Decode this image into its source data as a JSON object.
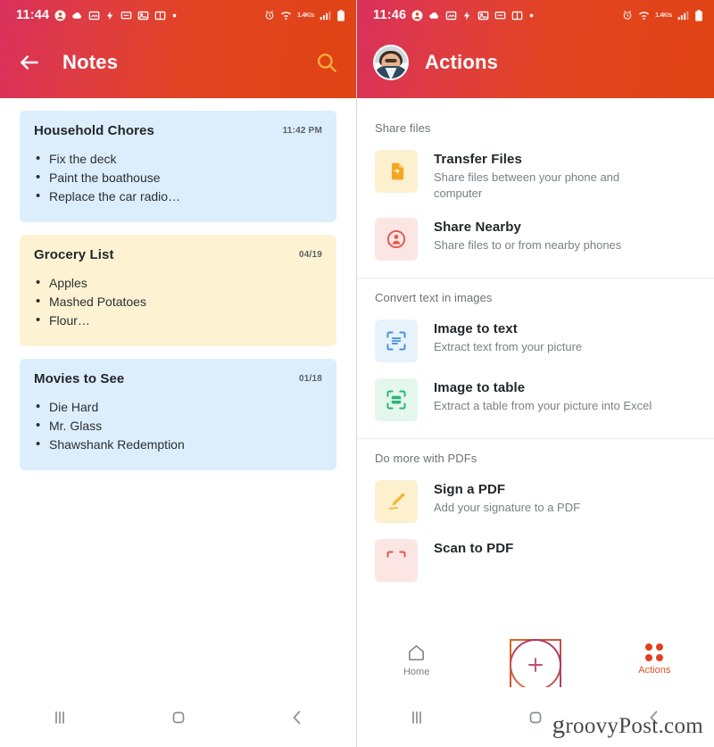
{
  "notes_phone": {
    "status_bar": {
      "time": "11:44",
      "network_speed": "1.4K/s",
      "icons": [
        "contact-icon",
        "weather-icon",
        "screenshot-icon",
        "flash-icon",
        "message-icon",
        "gallery-icon",
        "book-icon",
        "dot-icon"
      ],
      "right_icons": [
        "alarm-icon",
        "wifi-icon",
        "signal-icon",
        "battery-icon"
      ]
    },
    "app_bar": {
      "back_label": "back",
      "title": "Notes",
      "search_label": "search"
    },
    "notes": [
      {
        "title": "Household Chores",
        "stamp": "11:42 PM",
        "color": "blue",
        "items": [
          "Fix the deck",
          "Paint the boathouse",
          "Replace the car radio…"
        ]
      },
      {
        "title": "Grocery List",
        "stamp": "04/19",
        "color": "yellow",
        "items": [
          "Apples",
          "Mashed Potatoes",
          "Flour…"
        ]
      },
      {
        "title": "Movies to See",
        "stamp": "01/18",
        "color": "blue",
        "items": [
          "Die Hard",
          "Mr. Glass",
          "Shawshank Redemption"
        ]
      }
    ],
    "nav": {
      "recents": "recents",
      "home": "home",
      "back": "back"
    }
  },
  "actions_phone": {
    "status_bar": {
      "time": "11:46",
      "network_speed": "1.4K/s",
      "icons": [
        "contact-icon",
        "weather-icon",
        "screenshot-icon",
        "flash-icon",
        "gallery-icon",
        "message-icon",
        "book-icon",
        "dot-icon"
      ],
      "right_icons": [
        "alarm-icon",
        "wifi-icon",
        "signal-icon",
        "battery-icon"
      ]
    },
    "app_bar": {
      "title": "Actions",
      "avatar_label": "profile photo"
    },
    "sections": [
      {
        "title": "Share files",
        "rows": [
          {
            "icon": "transfer-files-icon",
            "icon_style": "ico-amber",
            "title": "Transfer Files",
            "subtitle": "Share files between your phone and computer"
          },
          {
            "icon": "share-nearby-icon",
            "icon_style": "ico-pink",
            "title": "Share Nearby",
            "subtitle": "Share files to or from nearby phones"
          }
        ]
      },
      {
        "title": "Convert text in images",
        "rows": [
          {
            "icon": "image-to-text-icon",
            "icon_style": "ico-blue",
            "title": "Image to text",
            "subtitle": "Extract text from your picture"
          },
          {
            "icon": "image-to-table-icon",
            "icon_style": "ico-green",
            "title": "Image to table",
            "subtitle": "Extract a table from your picture into Excel"
          }
        ]
      },
      {
        "title": "Do more with PDFs",
        "rows": [
          {
            "icon": "sign-pdf-icon",
            "icon_style": "ico-amber",
            "title": "Sign a PDF",
            "subtitle": "Add your signature to a PDF"
          },
          {
            "icon": "scan-to-pdf-icon",
            "icon_style": "ico-pink",
            "title": "Scan to PDF",
            "subtitle": ""
          }
        ]
      }
    ],
    "tab_bar": {
      "home_label": "Home",
      "fab_label": "add",
      "actions_label": "Actions"
    },
    "nav": {
      "recents": "recents",
      "home": "home",
      "back": "back"
    }
  },
  "watermark": {
    "lead": "g",
    "text": "roovyPost.com"
  },
  "colors": {
    "header_start": "#d9305c",
    "header_end": "#e04313",
    "note_blue": "#dceefb",
    "note_yellow": "#fdf3d3",
    "accent": "#e0401c"
  }
}
